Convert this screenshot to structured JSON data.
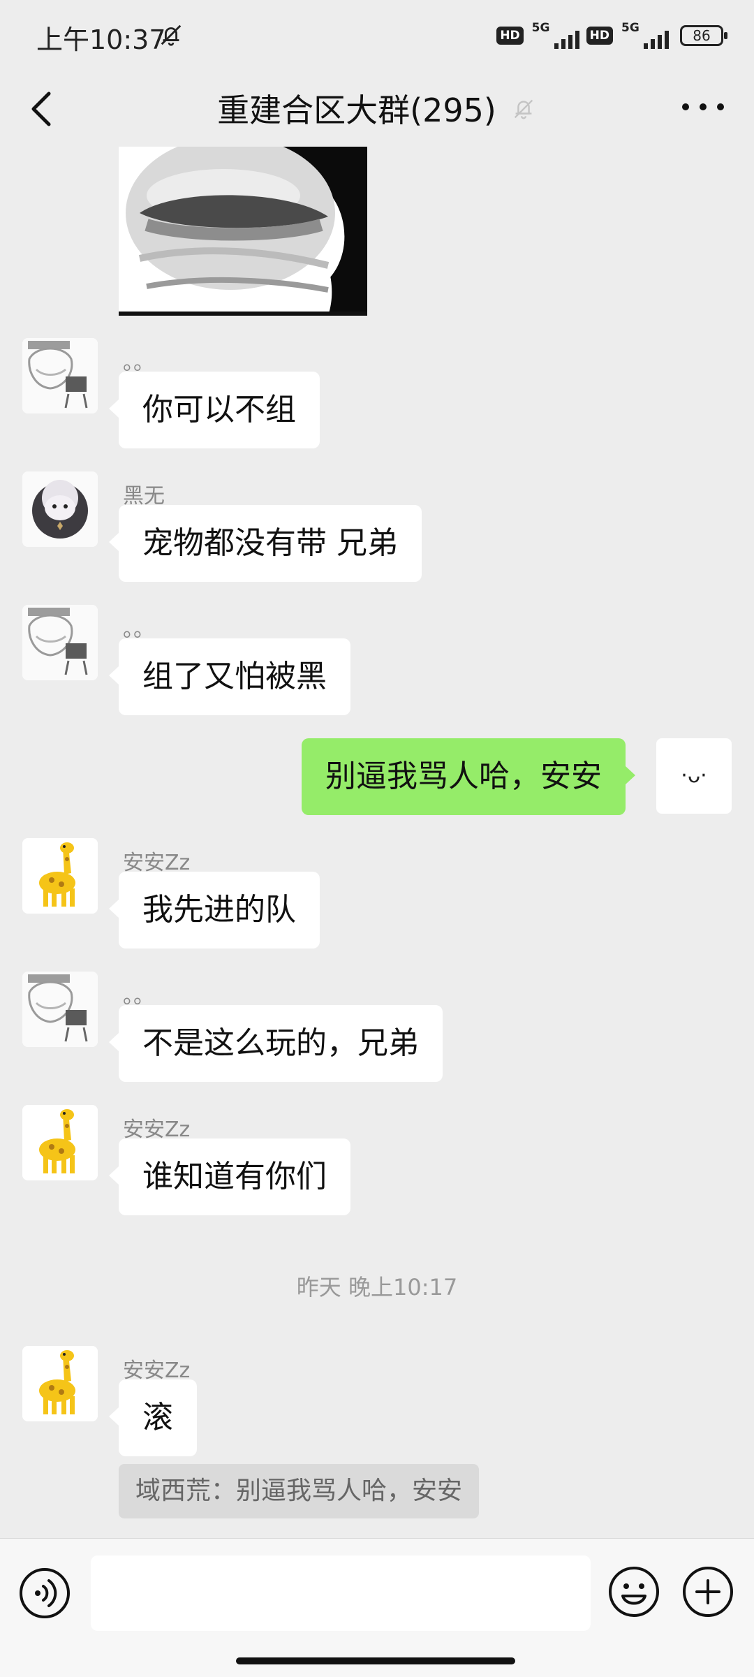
{
  "status_bar": {
    "time": "上午10:37",
    "hd_1": "HD",
    "net_1": "5G",
    "hd_2": "HD",
    "net_2": "5G",
    "battery": "86"
  },
  "header": {
    "title": "重建合区大群(295)",
    "back_icon": "chevron-left-icon",
    "mute_icon": "bell-off-icon",
    "more_icon": "more-dots-icon"
  },
  "messages": [
    {
      "sender": "。。",
      "text": "你可以不组",
      "avatar": "sketch-avatar"
    },
    {
      "sender": "黑无",
      "text": "宠物都没有带 兄弟",
      "avatar": "sheep-avatar"
    },
    {
      "sender": "。。",
      "text": "组了又怕被黑",
      "avatar": "sketch-avatar"
    },
    {
      "sender": "",
      "text": "别逼我骂人哈，安安",
      "self": true,
      "avatar_text": "·ᴗ·"
    },
    {
      "sender": "安安Zz",
      "text": "我先进的队",
      "avatar": "giraffe-avatar"
    },
    {
      "sender": "。。",
      "text": "不是这么玩的，兄弟",
      "avatar": "sketch-avatar"
    },
    {
      "sender": "安安Zz",
      "text": "谁知道有你们",
      "avatar": "giraffe-avatar"
    },
    {
      "sender": "安安Zz",
      "text": "滚",
      "avatar": "giraffe-avatar"
    }
  ],
  "timestamp": "昨天 晚上10:17",
  "quote": "域西荒：别逼我骂人哈，安安",
  "input_bar": {
    "voice_icon": "voice-icon",
    "emoji_icon": "emoji-icon",
    "plus_icon": "plus-icon"
  },
  "colors": {
    "background": "#ededed",
    "self_bubble": "#95ec69",
    "other_bubble": "#ffffff",
    "accent": "#07c160"
  }
}
